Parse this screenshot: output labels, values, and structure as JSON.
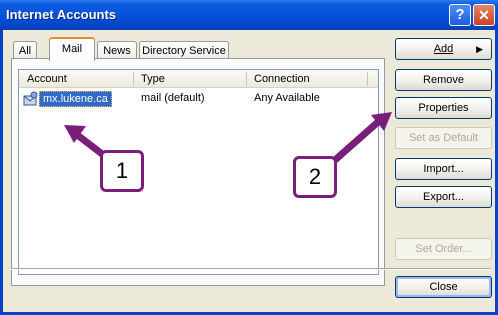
{
  "window": {
    "title": "Internet Accounts",
    "help_glyph": "?",
    "close_glyph": "✕"
  },
  "tabs": [
    {
      "label": "All"
    },
    {
      "label": "Mail"
    },
    {
      "label": "News"
    },
    {
      "label": "Directory Service"
    }
  ],
  "list": {
    "columns": [
      "Account",
      "Type",
      "Connection"
    ],
    "rows": [
      {
        "account": "mx.lukene.ca",
        "type": "mail (default)",
        "connection": "Any Available"
      }
    ]
  },
  "buttons": {
    "add": "Add",
    "remove": "Remove",
    "properties": "Properties",
    "set_default": "Set as Default",
    "import": "Import...",
    "export": "Export...",
    "set_order": "Set Order...",
    "close": "Close"
  },
  "annotations": {
    "callout1": "1",
    "callout2": "2",
    "color": "#7a1e7c"
  }
}
